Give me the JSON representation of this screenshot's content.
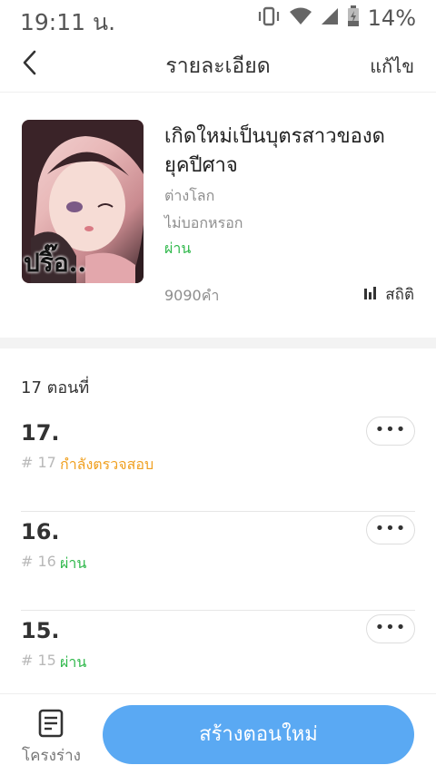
{
  "status_bar": {
    "time": "19:11 น.",
    "battery_percent": "14%",
    "icons": [
      "vibrate-icon",
      "wifi-icon",
      "signal-icon",
      "battery-icon"
    ]
  },
  "nav": {
    "title": "รายละเอียด",
    "edit_label": "แก้ไข",
    "back_icon": "chevron-left-icon"
  },
  "book": {
    "cover_caption": "ปริ๊อ..",
    "title": "เกิดใหม่เป็นบุตรสาวของดยุคปีศาจ",
    "category": "ต่างโลก",
    "tag": "ไม่บอกหรอก",
    "status": "ผ่าน",
    "word_count": "9090คำ",
    "stats_label": "สถิติ",
    "stats_icon": "bar-chart-icon"
  },
  "chapters": {
    "count_label": "17 ตอนที่",
    "more_label": "•••",
    "items": [
      {
        "number": "17.",
        "hash": "# 17",
        "state": "กำลังตรวจสอบ",
        "state_color": "#f0a020"
      },
      {
        "number": "16.",
        "hash": "# 16",
        "state": "ผ่าน",
        "state_color": "#2fb84b"
      },
      {
        "number": "15.",
        "hash": "# 15",
        "state": "ผ่าน",
        "state_color": "#2fb84b"
      }
    ]
  },
  "bottom": {
    "draft_label": "โครงร่าง",
    "draft_icon": "document-list-icon",
    "create_label": "สร้างตอนใหม่"
  },
  "colors": {
    "accent": "#5aa9f3",
    "approved": "#2fb84b",
    "pending": "#f0a020"
  }
}
